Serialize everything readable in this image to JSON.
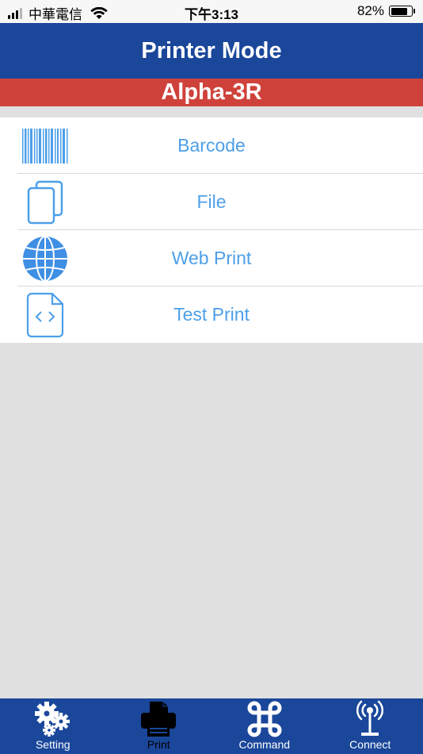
{
  "status_bar": {
    "carrier": "中華電信",
    "time": "下午3:13",
    "battery": "82%"
  },
  "header": {
    "title": "Printer Mode",
    "model": "Alpha-3R"
  },
  "menu": {
    "items": [
      {
        "label": "Barcode",
        "icon": "barcode-icon"
      },
      {
        "label": "File",
        "icon": "file-copy-icon"
      },
      {
        "label": "Web Print",
        "icon": "globe-icon"
      },
      {
        "label": "Test Print",
        "icon": "code-file-icon"
      }
    ]
  },
  "tab_bar": {
    "tabs": [
      {
        "label": "Setting",
        "icon": "gears-icon",
        "active": false
      },
      {
        "label": "Print",
        "icon": "printer-icon",
        "active": true
      },
      {
        "label": "Command",
        "icon": "command-icon",
        "active": false
      },
      {
        "label": "Connect",
        "icon": "antenna-icon",
        "active": false
      }
    ]
  },
  "colors": {
    "header_blue": "#1a479a",
    "banner_red": "#cf423b",
    "link_blue": "#4d9fe8",
    "background": "#e0e0e0"
  }
}
